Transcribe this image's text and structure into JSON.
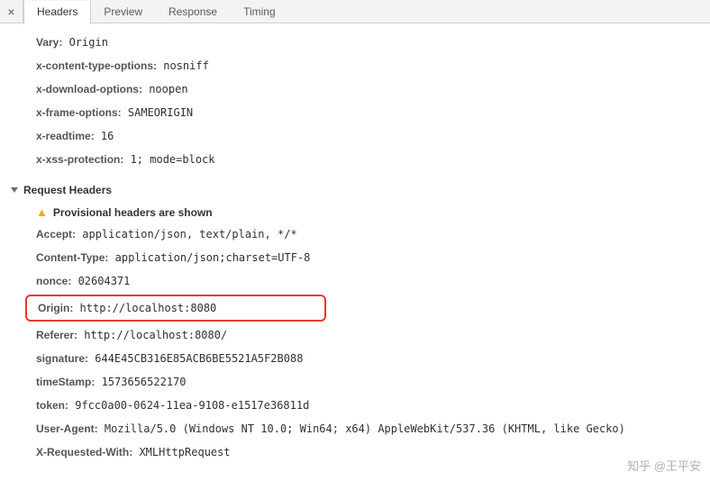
{
  "tabs": {
    "close": "×",
    "headers": "Headers",
    "preview": "Preview",
    "response": "Response",
    "timing": "Timing"
  },
  "response_headers": [
    {
      "name": "Vary:",
      "value": " Origin"
    },
    {
      "name": "x-content-type-options:",
      "value": " nosniff"
    },
    {
      "name": "x-download-options:",
      "value": " noopen"
    },
    {
      "name": "x-frame-options:",
      "value": " SAMEORIGIN"
    },
    {
      "name": "x-readtime:",
      "value": " 16"
    },
    {
      "name": "x-xss-protection:",
      "value": " 1; mode=block"
    }
  ],
  "section_title": "Request Headers",
  "provisional_warning": "Provisional headers are shown",
  "request_headers_top": [
    {
      "name": "Accept:",
      "value": " application/json, text/plain, */*"
    },
    {
      "name": "Content-Type:",
      "value": " application/json;charset=UTF-8"
    },
    {
      "name": "nonce:",
      "value": " 02604371"
    }
  ],
  "highlighted": {
    "name": "Origin:",
    "value": " http://localhost:8080"
  },
  "request_headers_bottom": [
    {
      "name": "Referer:",
      "value": " http://localhost:8080/"
    },
    {
      "name": "signature:",
      "value": " 644E45CB316E85ACB6BE5521A5F2B088"
    },
    {
      "name": "timeStamp:",
      "value": " 1573656522170"
    },
    {
      "name": "token:",
      "value": " 9fcc0a00-0624-11ea-9108-e1517e36811d"
    },
    {
      "name": "User-Agent:",
      "value": " Mozilla/5.0 (Windows NT 10.0; Win64; x64) AppleWebKit/537.36 (KHTML, like Gecko)"
    },
    {
      "name": "X-Requested-With:",
      "value": " XMLHttpRequest"
    }
  ],
  "watermark": "知乎 @王平安"
}
